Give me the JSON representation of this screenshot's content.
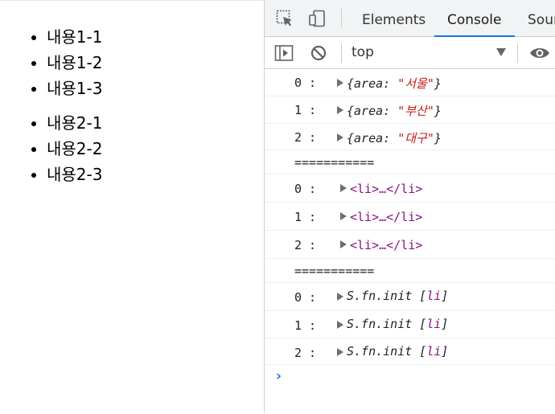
{
  "page": {
    "list1": [
      "내용1-1",
      "내용1-2",
      "내용1-3"
    ],
    "list2": [
      "내용2-1",
      "내용2-2",
      "내용2-3"
    ]
  },
  "devtools": {
    "tabs": [
      "Elements",
      "Console",
      "Sour"
    ],
    "active_tab": "Console",
    "context": "top",
    "accent": "#1a73e8"
  },
  "console": {
    "group1": [
      {
        "index": "0 :",
        "key": "area",
        "value": "\"서울\""
      },
      {
        "index": "1 :",
        "key": "area",
        "value": "\"부산\""
      },
      {
        "index": "2 :",
        "key": "area",
        "value": "\"대구\""
      }
    ],
    "separator": "===========",
    "group2": [
      {
        "index": "0 :",
        "text": "<li>…</li>"
      },
      {
        "index": "1 :",
        "text": "<li>…</li>"
      },
      {
        "index": "2 :",
        "text": "<li>…</li>"
      }
    ],
    "group3": [
      {
        "index": "0 :",
        "prefix": "S.fn.init [",
        "tag": "li",
        "suffix": "]"
      },
      {
        "index": "1 :",
        "prefix": "S.fn.init [",
        "tag": "li",
        "suffix": "]"
      },
      {
        "index": "2 :",
        "prefix": "S.fn.init [",
        "tag": "li",
        "suffix": "]"
      }
    ],
    "prompt": "›"
  }
}
